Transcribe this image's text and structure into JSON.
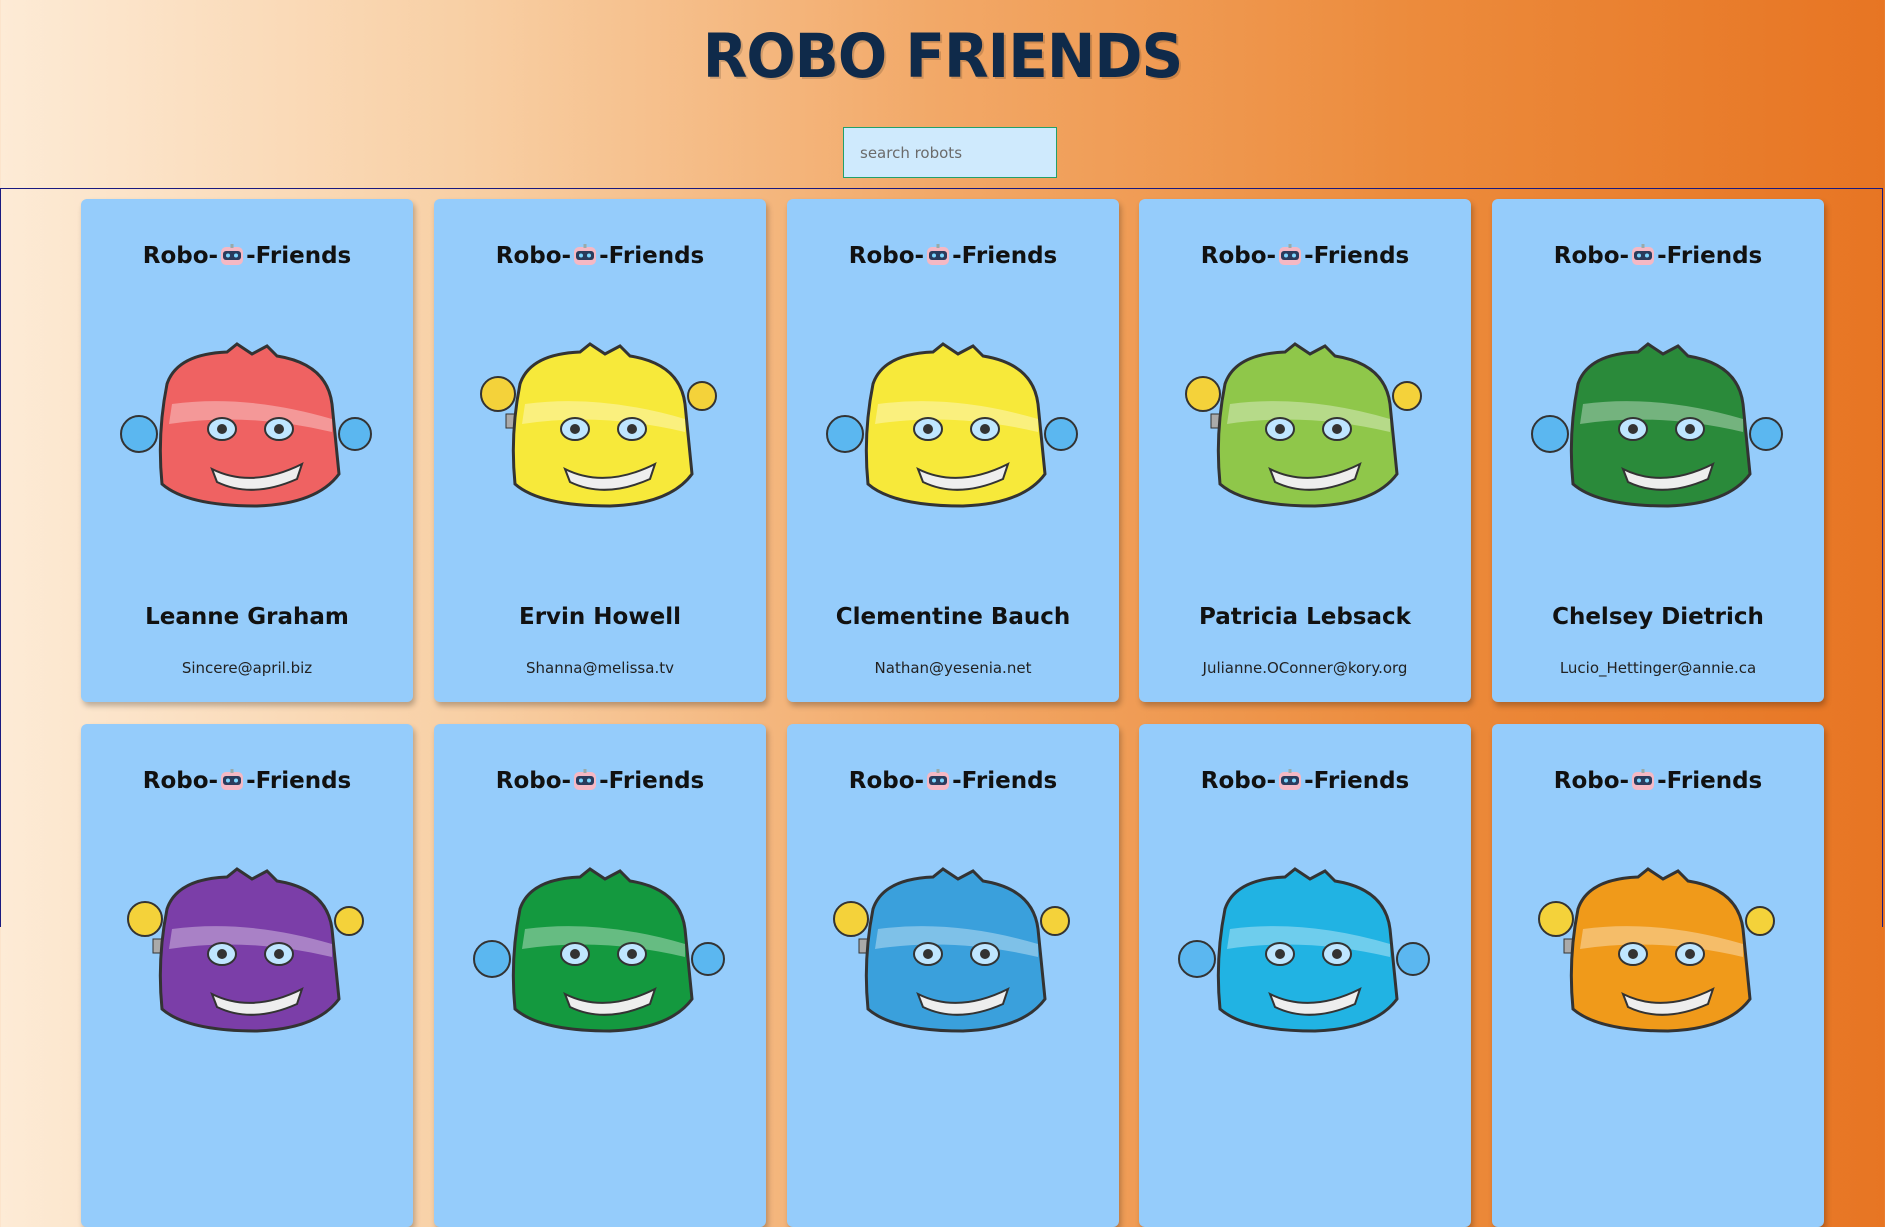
{
  "header": {
    "title": "ROBO FRIENDS",
    "search_placeholder": "search robots"
  },
  "card_header": {
    "prefix": "Robo-",
    "suffix": "-Friends",
    "icon": "robot-face-icon"
  },
  "robots": [
    {
      "name": "Leanne Graham",
      "email": "Sincere@april.biz",
      "color": "#ef6262"
    },
    {
      "name": "Ervin Howell",
      "email": "Shanna@melissa.tv",
      "color": "#f7e93a"
    },
    {
      "name": "Clementine Bauch",
      "email": "Nathan@yesenia.net",
      "color": "#f7e93a"
    },
    {
      "name": "Patricia Lebsack",
      "email": "Julianne.OConner@kory.org",
      "color": "#8fc74a"
    },
    {
      "name": "Chelsey Dietrich",
      "email": "Lucio_Hettinger@annie.ca",
      "color": "#2a8a3a"
    },
    {
      "name": "",
      "email": "",
      "color": "#7b3ea8"
    },
    {
      "name": "",
      "email": "",
      "color": "#14993f"
    },
    {
      "name": "",
      "email": "",
      "color": "#3aa0dc"
    },
    {
      "name": "",
      "email": "",
      "color": "#21b3e3"
    },
    {
      "name": "",
      "email": "",
      "color": "#f09a1a"
    }
  ]
}
